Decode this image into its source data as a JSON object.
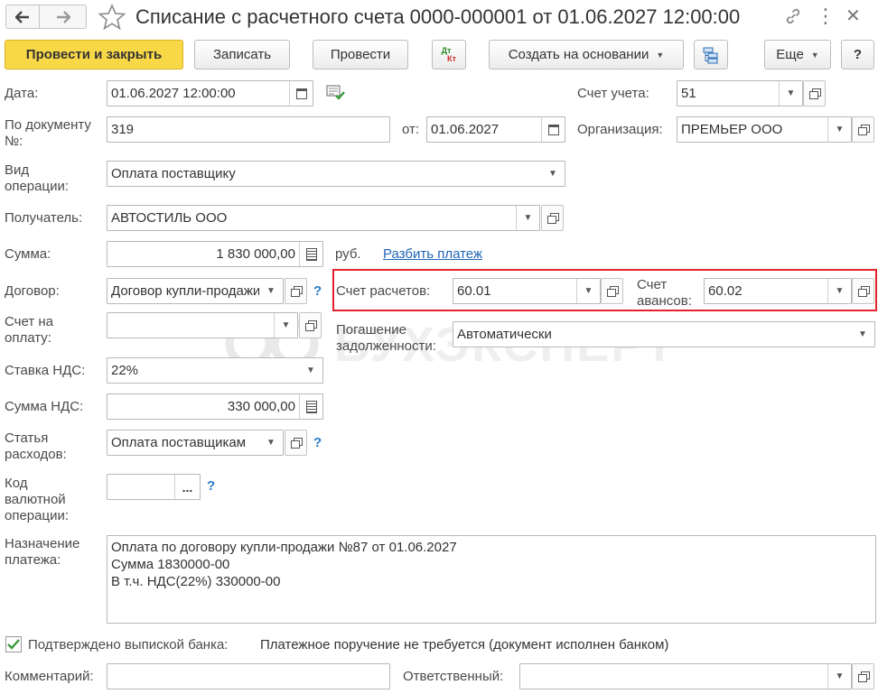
{
  "window": {
    "title": "Списание с расчетного счета 0000-000001 от 01.06.2027 12:00:00",
    "more_icon": "⋮",
    "close_icon": "✕"
  },
  "toolbar": {
    "post_close": "Провести и закрыть",
    "save": "Записать",
    "post": "Провести",
    "dt_label": "Дт",
    "kt_label": "Кт",
    "create_based": "Создать на основании",
    "more": "Еще",
    "help": "?"
  },
  "form": {
    "date": {
      "label": "Дата:",
      "value": "01.06.2027 12:00:00"
    },
    "account": {
      "label": "Счет учета:",
      "value": "51"
    },
    "doc_number": {
      "label": "По документу №:",
      "value": "319"
    },
    "doc_date": {
      "label": "от:",
      "value": "01.06.2027"
    },
    "organization": {
      "label": "Организация:",
      "value": "ПРЕМЬЕР ООО"
    },
    "operation_type": {
      "label": "Вид операции:",
      "value": "Оплата поставщику"
    },
    "recipient": {
      "label": "Получатель:",
      "value": "АВТОСТИЛЬ ООО"
    },
    "amount": {
      "label": "Сумма:",
      "value": "1 830 000,00",
      "currency": "руб.",
      "split_link": "Разбить платеж"
    },
    "contract": {
      "label": "Договор:",
      "value": "Договор купли-продажи",
      "help": "?"
    },
    "settlement_account": {
      "label": "Счет расчетов:",
      "value": "60.01"
    },
    "advance_account": {
      "label": "Счет авансов:",
      "value": "60.02"
    },
    "invoice": {
      "label": "Счет на оплату:",
      "value": ""
    },
    "debt_repayment": {
      "label": "Погашение задолженности:",
      "value": "Автоматически"
    },
    "vat_rate": {
      "label": "Ставка НДС:",
      "value": "22%"
    },
    "vat_amount": {
      "label": "Сумма НДС:",
      "value": "330 000,00"
    },
    "expense_item": {
      "label": "Статья расходов:",
      "value": "Оплата поставщикам",
      "help": "?"
    },
    "currency_op_code": {
      "label": "Код валютной операции:",
      "value": "",
      "button": "...",
      "help": "?"
    },
    "purpose": {
      "label": "Назначение платежа:",
      "lines": [
        "Оплата по договору купли-продажи №87 от 01.06.2027",
        "Сумма 1830000-00",
        "В т.ч. НДС(22%) 330000-00"
      ]
    },
    "bank_confirmed": {
      "label": "Подтверждено выпиской банка:",
      "checked": true,
      "status": "Платежное поручение не требуется (документ исполнен банком)"
    },
    "comment": {
      "label": "Комментарий:",
      "value": ""
    },
    "responsible": {
      "label": "Ответственный:",
      "value": ""
    }
  },
  "watermark": "БУХЭКСПЕРТ",
  "colors": {
    "primary_button": "#f9d848",
    "highlight_box": "#e3222e",
    "link": "#1f65b8",
    "check": "#3b9b3b"
  }
}
